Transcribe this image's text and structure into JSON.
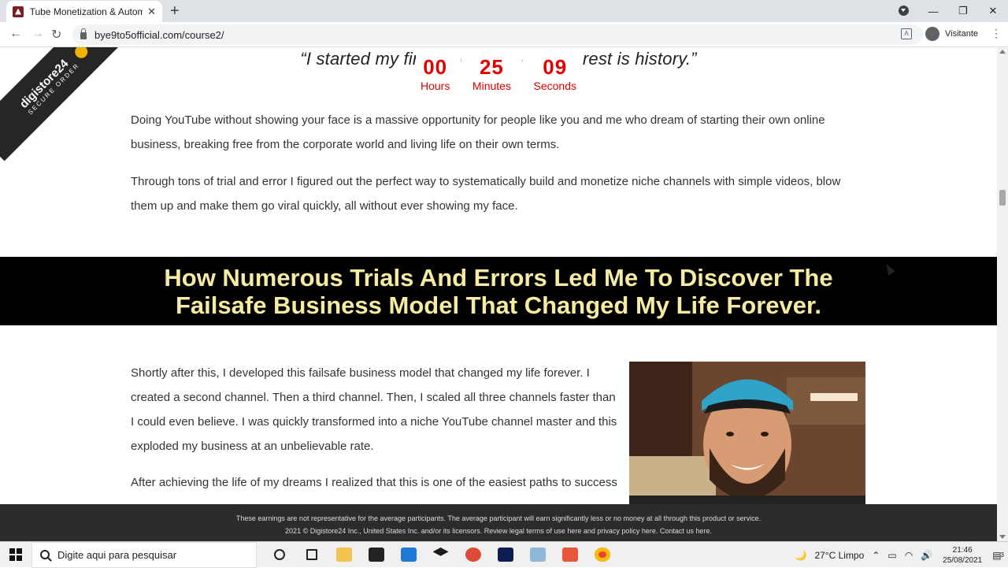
{
  "browser": {
    "tab_title": "Tube Monetization & Automatio",
    "url": "bye9to5official.com/course2/",
    "profile_label": "Visitante"
  },
  "page": {
    "quote": "“I started my first YouTub                                   y, and the rest is history.”",
    "countdown": {
      "hours_value": "00",
      "hours_label": "Hours",
      "minutes_value": "25",
      "minutes_label": "Minutes",
      "seconds_value": "09",
      "seconds_label": "Seconds"
    },
    "paragraph1": "Doing YouTube without showing your face is a massive opportunity for people like you and me who dream of starting their own online business, breaking free from the corporate world and living life on their own terms.",
    "paragraph2": "Through tons of trial and error I figured out the perfect way to systematically build and monetize niche channels with simple videos, blow them up and make them go viral quickly, all without ever showing my face.",
    "banner_heading": "How Numerous Trials And Errors Led Me To Discover The Failsafe Business Model That Changed My Life Forever.",
    "paragraph3": "Shortly after this, I developed this failsafe business model that changed my life forever. I created a second channel. Then a third channel. Then, I scaled all three channels faster than I could even believe. I was quickly transformed into a niche YouTube channel master and this exploded my business at an unbelievable rate.",
    "paragraph4": "After achieving the life of my dreams I realized that this is one of the easiest paths to success",
    "digistore_logo": "digistore24",
    "digistore_sub": "SECURE ORDER"
  },
  "footer": {
    "line1": "These earnings are not representative for the average participants. The average participant will earn significantly less or no money at all through this product or service.",
    "line2": "2021 © Digistore24 Inc., United States Inc. and/or its licensors. Review legal terms of use here and privacy policy here. Contact us here."
  },
  "taskbar": {
    "search_placeholder": "Digite aqui para pesquisar",
    "weather": "27°C  Limpo",
    "time": "21:46",
    "date": "25/08/2021",
    "notification_count": "3"
  },
  "colors": {
    "countdown_red": "#e00000",
    "banner_bg": "#000000",
    "banner_text": "#f6eba2"
  }
}
